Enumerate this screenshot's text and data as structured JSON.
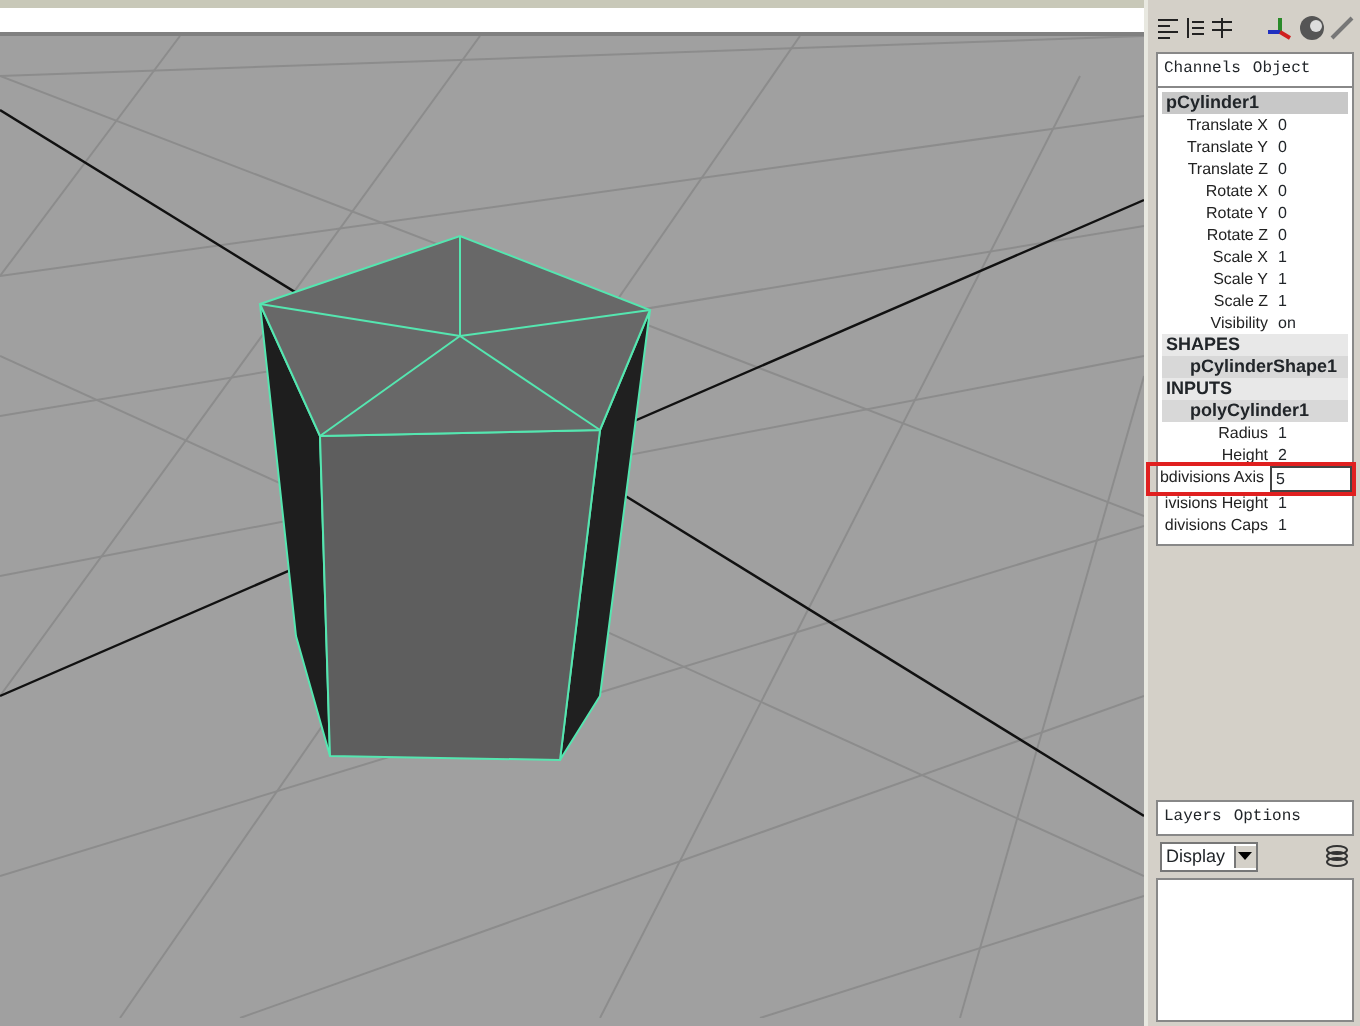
{
  "channel_box": {
    "menus": [
      "Channels",
      "Object"
    ],
    "node": "pCylinder1",
    "attributes": [
      {
        "label": "Translate X",
        "value": "0"
      },
      {
        "label": "Translate Y",
        "value": "0"
      },
      {
        "label": "Translate Z",
        "value": "0"
      },
      {
        "label": "Rotate X",
        "value": "0"
      },
      {
        "label": "Rotate Y",
        "value": "0"
      },
      {
        "label": "Rotate Z",
        "value": "0"
      },
      {
        "label": "Scale X",
        "value": "1"
      },
      {
        "label": "Scale Y",
        "value": "1"
      },
      {
        "label": "Scale Z",
        "value": "1"
      },
      {
        "label": "Visibility",
        "value": "on"
      }
    ],
    "sections": [
      {
        "title": "SHAPES",
        "node": "pCylinderShape1"
      },
      {
        "title": "INPUTS",
        "node": "polyCylinder1",
        "attributes": [
          {
            "label": "Radius",
            "value": "1",
            "editing": false
          },
          {
            "label": "Height",
            "value": "2",
            "editing": false
          },
          {
            "label": "bdivisions Axis",
            "value": "5",
            "editing": true
          },
          {
            "label": "ivisions Height",
            "value": "1",
            "editing": false
          },
          {
            "label": "divisions Caps",
            "value": "1",
            "editing": false
          }
        ]
      }
    ]
  },
  "layer_editor": {
    "menus": [
      "Layers",
      "Options"
    ],
    "dropdown": "Display"
  }
}
